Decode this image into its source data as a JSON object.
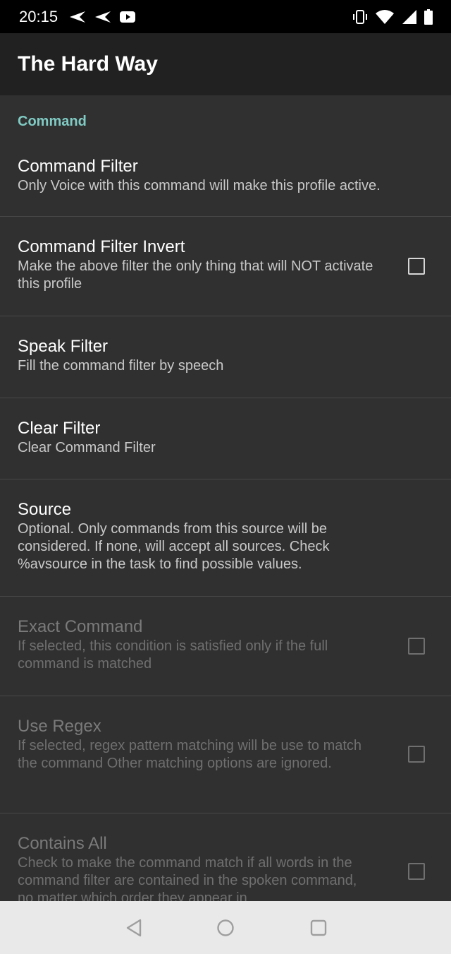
{
  "status_bar": {
    "time": "20:15",
    "left_icons": [
      "send-icon",
      "send-icon",
      "youtube-icon"
    ],
    "right_icons": [
      "vibrate-icon",
      "wifi-icon",
      "cell-signal-icon",
      "battery-icon"
    ]
  },
  "app_bar": {
    "title": "The Hard Way"
  },
  "category": {
    "label": "Command"
  },
  "prefs": [
    {
      "title": "Command Filter",
      "summary": "Only Voice with this command will make this profile active.",
      "enabled": true,
      "checkbox": false
    },
    {
      "title": "Command Filter Invert",
      "summary": "Make the above filter the only thing that will NOT activate this profile",
      "enabled": true,
      "checkbox": true,
      "checked": false
    },
    {
      "title": "Speak Filter",
      "summary": "Fill the command filter by speech",
      "enabled": true,
      "checkbox": false
    },
    {
      "title": "Clear Filter",
      "summary": "Clear Command Filter",
      "enabled": true,
      "checkbox": false
    },
    {
      "title": "Source",
      "summary": "Optional. Only commands from this source will be considered. If none, will accept all sources. Check %avsource in the task to find possible values.",
      "enabled": true,
      "checkbox": false
    },
    {
      "title": "Exact Command",
      "summary": "If selected, this condition is satisfied only if the full command is matched",
      "enabled": false,
      "checkbox": true,
      "checked": false
    },
    {
      "title": "Use Regex",
      "summary": "If selected, regex pattern matching will be use to match the command Other matching options are ignored.",
      "enabled": false,
      "checkbox": true,
      "checked": false
    },
    {
      "title": "Contains All",
      "summary": "Check to make the command match if all words in the command filter are contained in the spoken command, no matter which order they appear in",
      "enabled": false,
      "checkbox": true,
      "checked": false
    }
  ],
  "nav_bar": {
    "buttons": [
      "back-icon",
      "home-icon",
      "recents-icon"
    ]
  },
  "colors": {
    "accent": "#80cbc4",
    "background": "#303030",
    "app_bar": "#212121",
    "nav_bar": "#e9e9e9"
  }
}
